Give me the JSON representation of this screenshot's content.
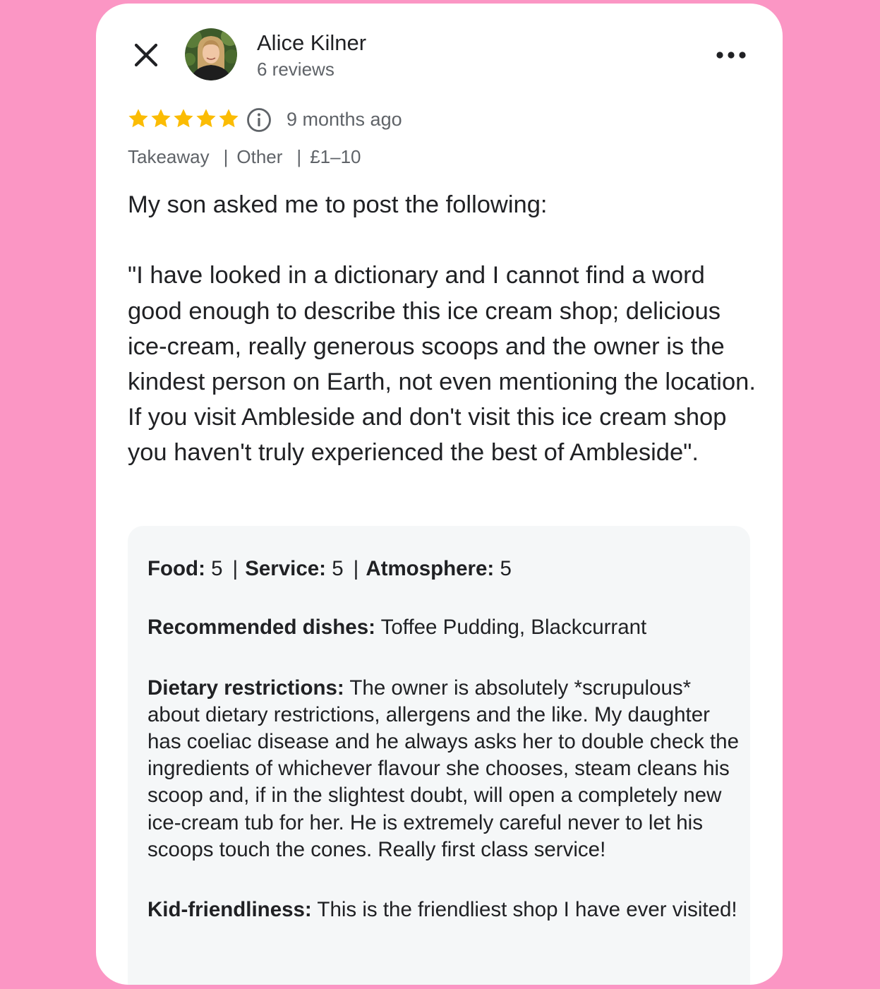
{
  "header": {
    "author_name": "Alice Kilner",
    "review_count": "6 reviews",
    "close_icon": "close-icon",
    "more_icon": "more-horizontal-icon"
  },
  "rating": {
    "stars": 5,
    "max_stars": 5,
    "star_color": "#fbbc04",
    "time_ago": "9 months ago",
    "info_icon": "info-icon"
  },
  "meta": {
    "service_type": "Takeaway",
    "meal_type": "Other",
    "price_range": "£1–10"
  },
  "review_text": "My son asked me to post the following:\n\n\"I have looked in a dictionary and I cannot find a word good enough to describe this ice cream shop; delicious ice-cream, really generous scoops and the owner is the kindest person on Earth, not even mentioning the location.  If you visit Ambleside and don't visit this ice cream shop you haven't truly experienced the best of Ambleside\".",
  "details": {
    "ratings": {
      "food_label": "Food:",
      "food_value": "5",
      "service_label": "Service:",
      "service_value": "5",
      "atmosphere_label": "Atmosphere:",
      "atmosphere_value": "5"
    },
    "recommended_dishes": {
      "label": "Recommended dishes:",
      "value": "Toffee Pudding, Blackcurrant"
    },
    "dietary_restrictions": {
      "label": "Dietary restrictions:",
      "value": "The owner is absolutely *scrupulous* about dietary restrictions, allergens and the like.  My daughter has coeliac disease and he always asks her to double check the ingredients of whichever flavour she chooses, steam cleans his scoop and, if in the slightest doubt, will open a completely new ice-cream tub for her.  He is extremely careful never to let his scoops touch the cones.  Really first class service!"
    },
    "kid_friendliness": {
      "label": "Kid-friendliness:",
      "value": "This is the friendliest shop I have ever visited!"
    }
  },
  "colors": {
    "page_background": "#fb96c4",
    "card_background": "#ffffff",
    "details_background": "#f5f7f8",
    "primary_text": "#202124",
    "secondary_text": "#5f6368"
  }
}
